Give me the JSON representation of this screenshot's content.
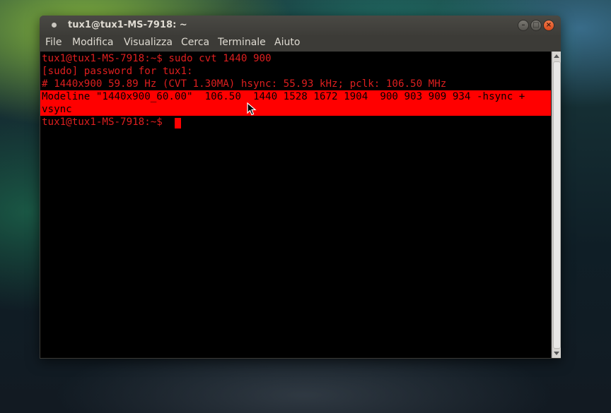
{
  "window": {
    "title": "tux1@tux1-MS-7918: ~",
    "controls": {
      "minimize": "–",
      "maximize": "□",
      "close": "×"
    }
  },
  "menu": {
    "items": [
      "File",
      "Modifica",
      "Visualizza",
      "Cerca",
      "Terminale",
      "Aiuto"
    ]
  },
  "terminal": {
    "lines": [
      "tux1@tux1-MS-7918:~$ sudo cvt 1440 900",
      "[sudo] password for tux1:",
      "# 1440x900 59.89 Hz (CVT 1.30MA) hsync: 55.93 kHz; pclk: 106.50 MHz"
    ],
    "modeline_keyword": "Modeline",
    "modeline_rest_1": " \"1440x900_60.00\"  106.50  1440 1528 1672 1904  900 903 909 934 -hsync +",
    "modeline_rest_2": "vsync",
    "prompt": "tux1@tux1-MS-7918:~$ "
  },
  "colors": {
    "terminal_text": "#dd1f1f",
    "highlight": "#ff0000",
    "background": "#000000"
  }
}
